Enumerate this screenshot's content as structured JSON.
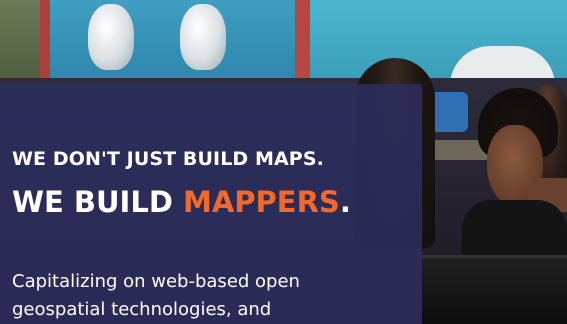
{
  "hero": {
    "headline_1": "WE DON'T JUST BUILD MAPS.",
    "headline_2_prefix": "WE BUILD ",
    "headline_2_accent": "MAPPERS",
    "headline_2_suffix": ".",
    "body_line_1": "Capitalizing on web-based open",
    "body_line_2": "geospatial technologies, and"
  },
  "colors": {
    "panel": "#2c2f5f",
    "accent": "#f26a2b",
    "text": "#ffffff"
  },
  "image": {
    "scene": "students-at-computers-photo"
  }
}
